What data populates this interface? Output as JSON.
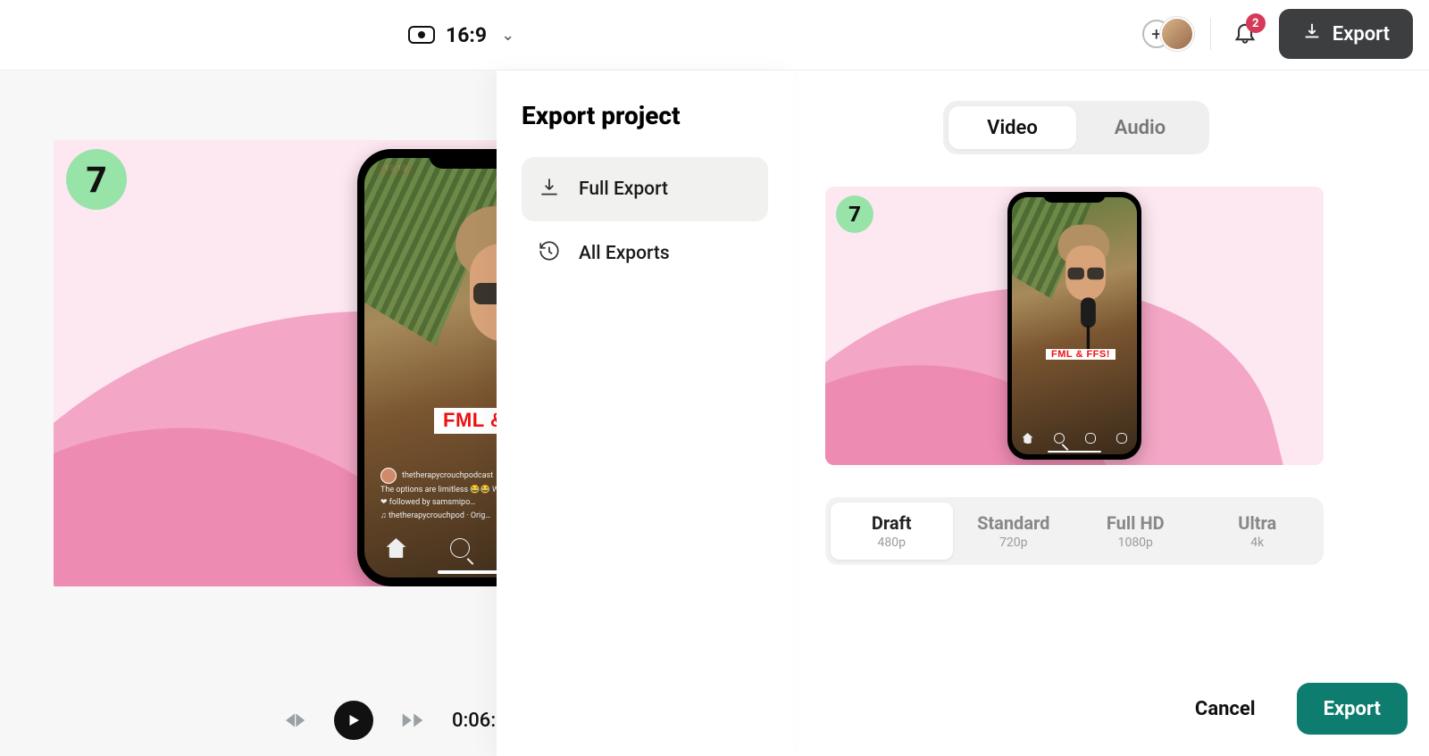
{
  "header": {
    "aspect_ratio": "16:9",
    "notification_count": "2",
    "export_button": "Export"
  },
  "preview": {
    "badge_number": "7",
    "caption": "FML & FFS",
    "feed_handle": "thetherapycrouchpodcast",
    "feed_line2": "The options are limitless 😂😂 What's your",
    "feed_line3": "❤ followed by samsmipo…",
    "feed_audio": "♫ thetherapycrouchpod · Orig…",
    "status_time": "19:10"
  },
  "transport": {
    "time": "0:06:"
  },
  "sidebar": {
    "title": "Export project",
    "items": [
      {
        "label": "Full Export"
      },
      {
        "label": "All Exports"
      }
    ]
  },
  "panel": {
    "tabs": {
      "video": "Video",
      "audio": "Audio"
    },
    "mini_badge": "7",
    "mini_caption": "FML & FFS!",
    "quality": [
      {
        "label": "Draft",
        "sub": "480p"
      },
      {
        "label": "Standard",
        "sub": "720p"
      },
      {
        "label": "Full HD",
        "sub": "1080p"
      },
      {
        "label": "Ultra",
        "sub": "4k"
      }
    ],
    "cancel": "Cancel",
    "export": "Export"
  }
}
